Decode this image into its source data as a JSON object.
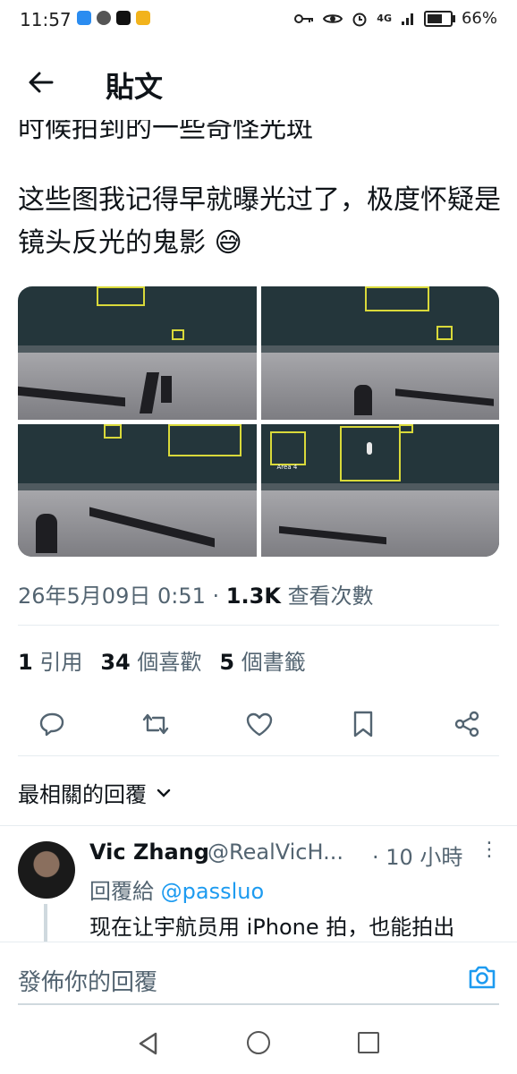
{
  "status_bar": {
    "time": "11:57",
    "battery": "66%",
    "network": "4G"
  },
  "header": {
    "title": "貼文",
    "back_icon": "arrow-left-icon"
  },
  "tweet": {
    "partial_line": "时候拍到的一些奇怪光斑",
    "text": "这些图我记得早就曝光过了，极度怀疑是镜头反光的鬼影 😅",
    "media_label": "Area 4",
    "timestamp": "26年5月09日 0:51",
    "separator": "·",
    "views_count": "1.3K",
    "views_label": "查看次數",
    "quotes_count": "1",
    "quotes_label": "引用",
    "likes_count": "34",
    "likes_label": "個喜歡",
    "bookmarks_count": "5",
    "bookmarks_label": "個書籤"
  },
  "actions": [
    "reply-icon",
    "retweet-icon",
    "like-icon",
    "bookmark-icon",
    "share-icon"
  ],
  "replies_header": {
    "label": "最相關的回覆",
    "chevron": "chevron-down-icon"
  },
  "reply": {
    "name": "Vic Zhang",
    "handle": "@RealVicH...",
    "time": "· 10 小時",
    "reply_to_label": "回覆給",
    "reply_to_user": "@passluo",
    "text": "现在让宇航员用 iPhone 拍，也能拍出"
  },
  "compose": {
    "placeholder": "發佈你的回覆"
  },
  "colors": {
    "link": "#1d9bf0",
    "secondary_text": "#536471",
    "primary_text": "#0f1419"
  }
}
